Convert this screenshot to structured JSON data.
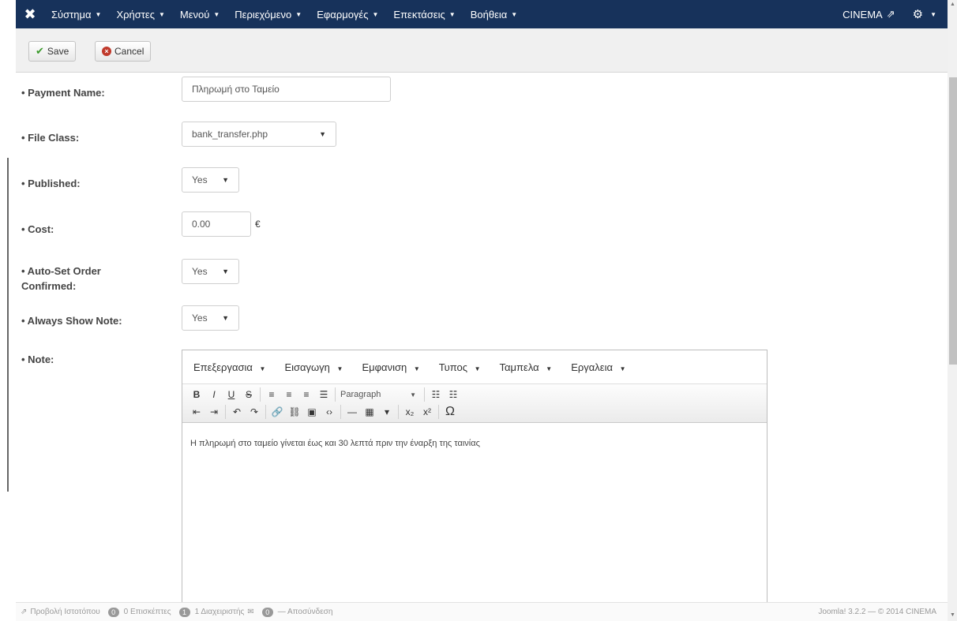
{
  "navbar": {
    "logo_icon": "joomla-logo-icon",
    "menu": [
      {
        "label": "Σύστημα"
      },
      {
        "label": "Χρήστες"
      },
      {
        "label": "Μενού"
      },
      {
        "label": "Περιεχόμενο"
      },
      {
        "label": "Εφαρμογές"
      },
      {
        "label": "Επεκτάσεις"
      },
      {
        "label": "Βοήθεια"
      }
    ],
    "site_label": "CINEMA",
    "external_icon": "external-link-icon",
    "settings_icon": "gear-icon"
  },
  "toolbar": {
    "save_label": "Save",
    "cancel_label": "Cancel"
  },
  "form": {
    "payment_name": {
      "label": "• Payment Name:",
      "value": "Πληρωμή στο Ταμείο"
    },
    "file_class": {
      "label": "• File Class:",
      "value": "bank_transfer.php"
    },
    "published": {
      "label": "• Published:",
      "value": "Yes"
    },
    "cost": {
      "label": "• Cost:",
      "value": "0.00",
      "currency": "€"
    },
    "auto_set": {
      "label": "• Auto-Set Order Confirmed:",
      "value": "Yes"
    },
    "always_show_note": {
      "label": "• Always Show Note:",
      "value": "Yes"
    },
    "note": {
      "label": "• Note:"
    }
  },
  "editor": {
    "menus": [
      {
        "label": "Επεξεργασια"
      },
      {
        "label": "Εισαγωγη"
      },
      {
        "label": "Εμφανιση"
      },
      {
        "label": "Τυπος"
      },
      {
        "label": "Ταμπελα"
      },
      {
        "label": "Εργαλεια"
      }
    ],
    "format_select": "Paragraph",
    "content": "Η πληρωμή στο ταμείο γίνεται έως και 30 λεπτά πριν την έναρξη της ταινίας"
  },
  "statusbar": {
    "view_site": "Προβολή Ιστοτόπου",
    "visitors_count": "0",
    "visitors_label": "0 Επισκέπτες",
    "admins_count": "1",
    "admins_label": "1 Διαχειριστής",
    "messages_count": "0",
    "logout_label": "— Αποσύνδεση",
    "version": "Joomla! 3.2.2 — © 2014 CINEMA"
  }
}
